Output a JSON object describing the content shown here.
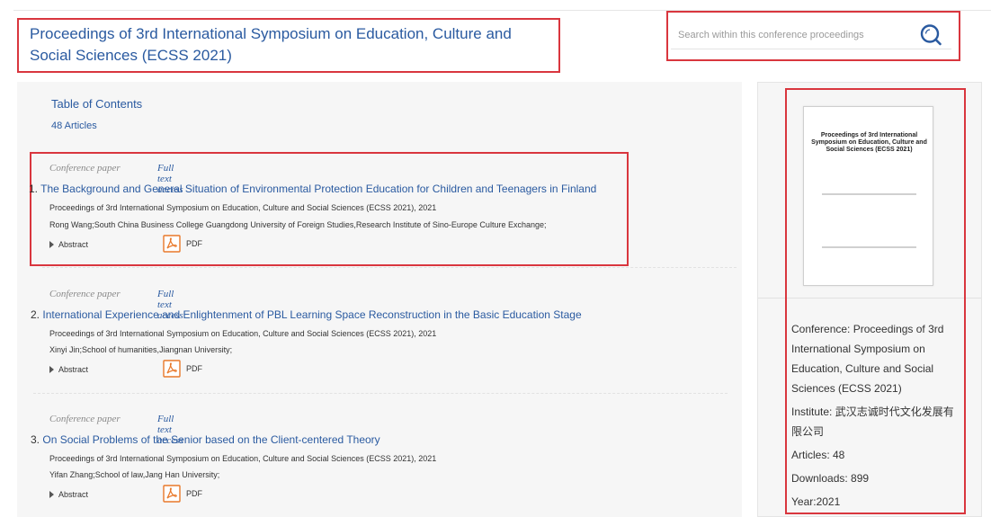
{
  "header": {
    "title": "Proceedings of 3rd International Symposium on Education, Culture and Social Sciences (ECSS 2021)"
  },
  "search": {
    "placeholder": "Search within this conference proceedings",
    "icon": "search-icon"
  },
  "toc": {
    "title": "Table of Contents",
    "count": "48 Articles"
  },
  "articles": [
    {
      "type": "Conference paper",
      "access": "Full text access",
      "number": "1.",
      "title": "The Background and General Situation of Environmental Protection Education for Children and Teenagers in Finland",
      "publication": "Proceedings of 3rd International Symposium on Education, Culture and Social Sciences (ECSS 2021), 2021",
      "authors": "Rong Wang;South China Business College Guangdong University of Foreign Studies,Research Institute of Sino-Europe Culture Exchange;",
      "abstract_label": "Abstract",
      "pdf_label": "PDF"
    },
    {
      "type": "Conference paper",
      "access": "Full text access",
      "number": "2.",
      "title": "International Experience and Enlightenment of PBL Learning Space Reconstruction in the Basic Education Stage",
      "publication": "Proceedings of 3rd International Symposium on Education, Culture and Social Sciences (ECSS 2021), 2021",
      "authors": "Xinyi Jin;School of humanities,Jiangnan University;",
      "abstract_label": "Abstract",
      "pdf_label": "PDF"
    },
    {
      "type": "Conference paper",
      "access": "Full text access",
      "number": "3.",
      "title": "On Social Problems of the Senior based on the Client-centered Theory",
      "publication": "Proceedings of 3rd International Symposium on Education, Culture and Social Sciences (ECSS 2021), 2021",
      "authors": "Yifan Zhang;School of law,Jang Han University;",
      "abstract_label": "Abstract",
      "pdf_label": "PDF"
    }
  ],
  "sidebar": {
    "cover_title": "Proceedings of 3rd International Symposium on Education, Culture and Social Sciences (ECSS 2021)",
    "conference": "Conference: Proceedings of 3rd International Symposium on Education, Culture and Social Sciences (ECSS 2021)",
    "institute": "Institute: 武汉志诚时代文化发展有限公司",
    "articles": "Articles: 48",
    "downloads": "Downloads: 899",
    "year": "Year:2021"
  },
  "colors": {
    "accent": "#2a5aa0",
    "highlight": "#d9363e",
    "pdf": "#e8782a"
  }
}
